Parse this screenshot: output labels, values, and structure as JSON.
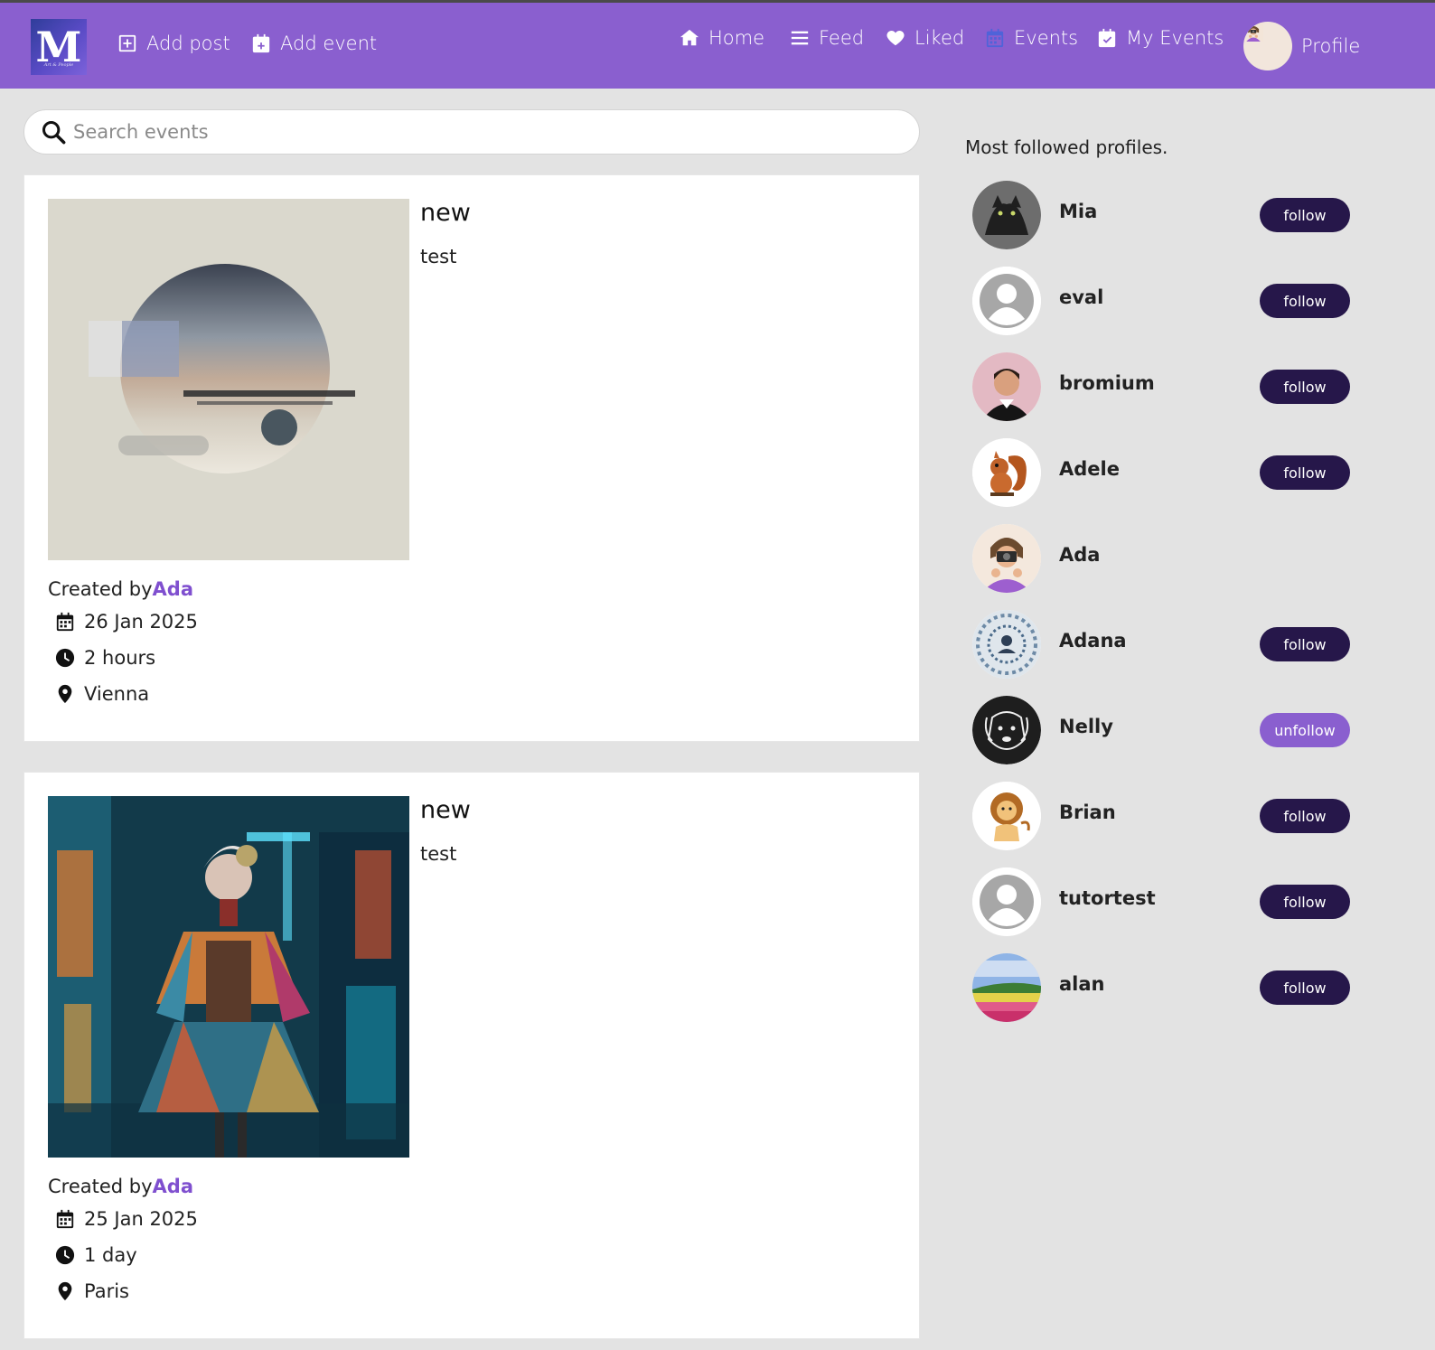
{
  "nav": {
    "logo": {
      "letter": "M",
      "tagline": "Art & People"
    },
    "add_post": "Add post",
    "add_event": "Add event",
    "home": "Home",
    "feed": "Feed",
    "liked": "Liked",
    "events": "Events",
    "my_events": "My Events",
    "profile": "Profile"
  },
  "search": {
    "placeholder": "Search events",
    "value": ""
  },
  "events": [
    {
      "title": "new",
      "description": "test",
      "created_by_label": "Created by",
      "author": "Ada",
      "date": "26 Jan 2025",
      "duration": "2 hours",
      "location": "Vienna",
      "image": "abstract-circle-art"
    },
    {
      "title": "new",
      "description": "test",
      "created_by_label": "Created by",
      "author": "Ada",
      "date": "25 Jan 2025",
      "duration": "1 day",
      "location": "Paris",
      "image": "neon-fashion-portrait"
    }
  ],
  "sidebar": {
    "title": "Most followed profiles.",
    "profiles": [
      {
        "name": "Mia",
        "button": "follow",
        "avatar": "cat-photo"
      },
      {
        "name": "eval",
        "button": "follow",
        "avatar": "default-avatar"
      },
      {
        "name": "bromium",
        "button": "follow",
        "avatar": "man-portrait"
      },
      {
        "name": "Adele",
        "button": "follow",
        "avatar": "squirrel"
      },
      {
        "name": "Ada",
        "button": "",
        "avatar": "photographer"
      },
      {
        "name": "Adana",
        "button": "follow",
        "avatar": "icon-collage"
      },
      {
        "name": "Nelly",
        "button": "unfollow",
        "avatar": "dog-sketch"
      },
      {
        "name": "Brian",
        "button": "follow",
        "avatar": "lion-cartoon"
      },
      {
        "name": "tutortest",
        "button": "follow",
        "avatar": "default-avatar"
      },
      {
        "name": "alan",
        "button": "follow",
        "avatar": "tulip-field"
      }
    ]
  },
  "colors": {
    "navbar": "#8a5fcf",
    "follow": "#26174a",
    "unfollow": "#8a5fcf",
    "author_link": "#7f4fcf"
  }
}
